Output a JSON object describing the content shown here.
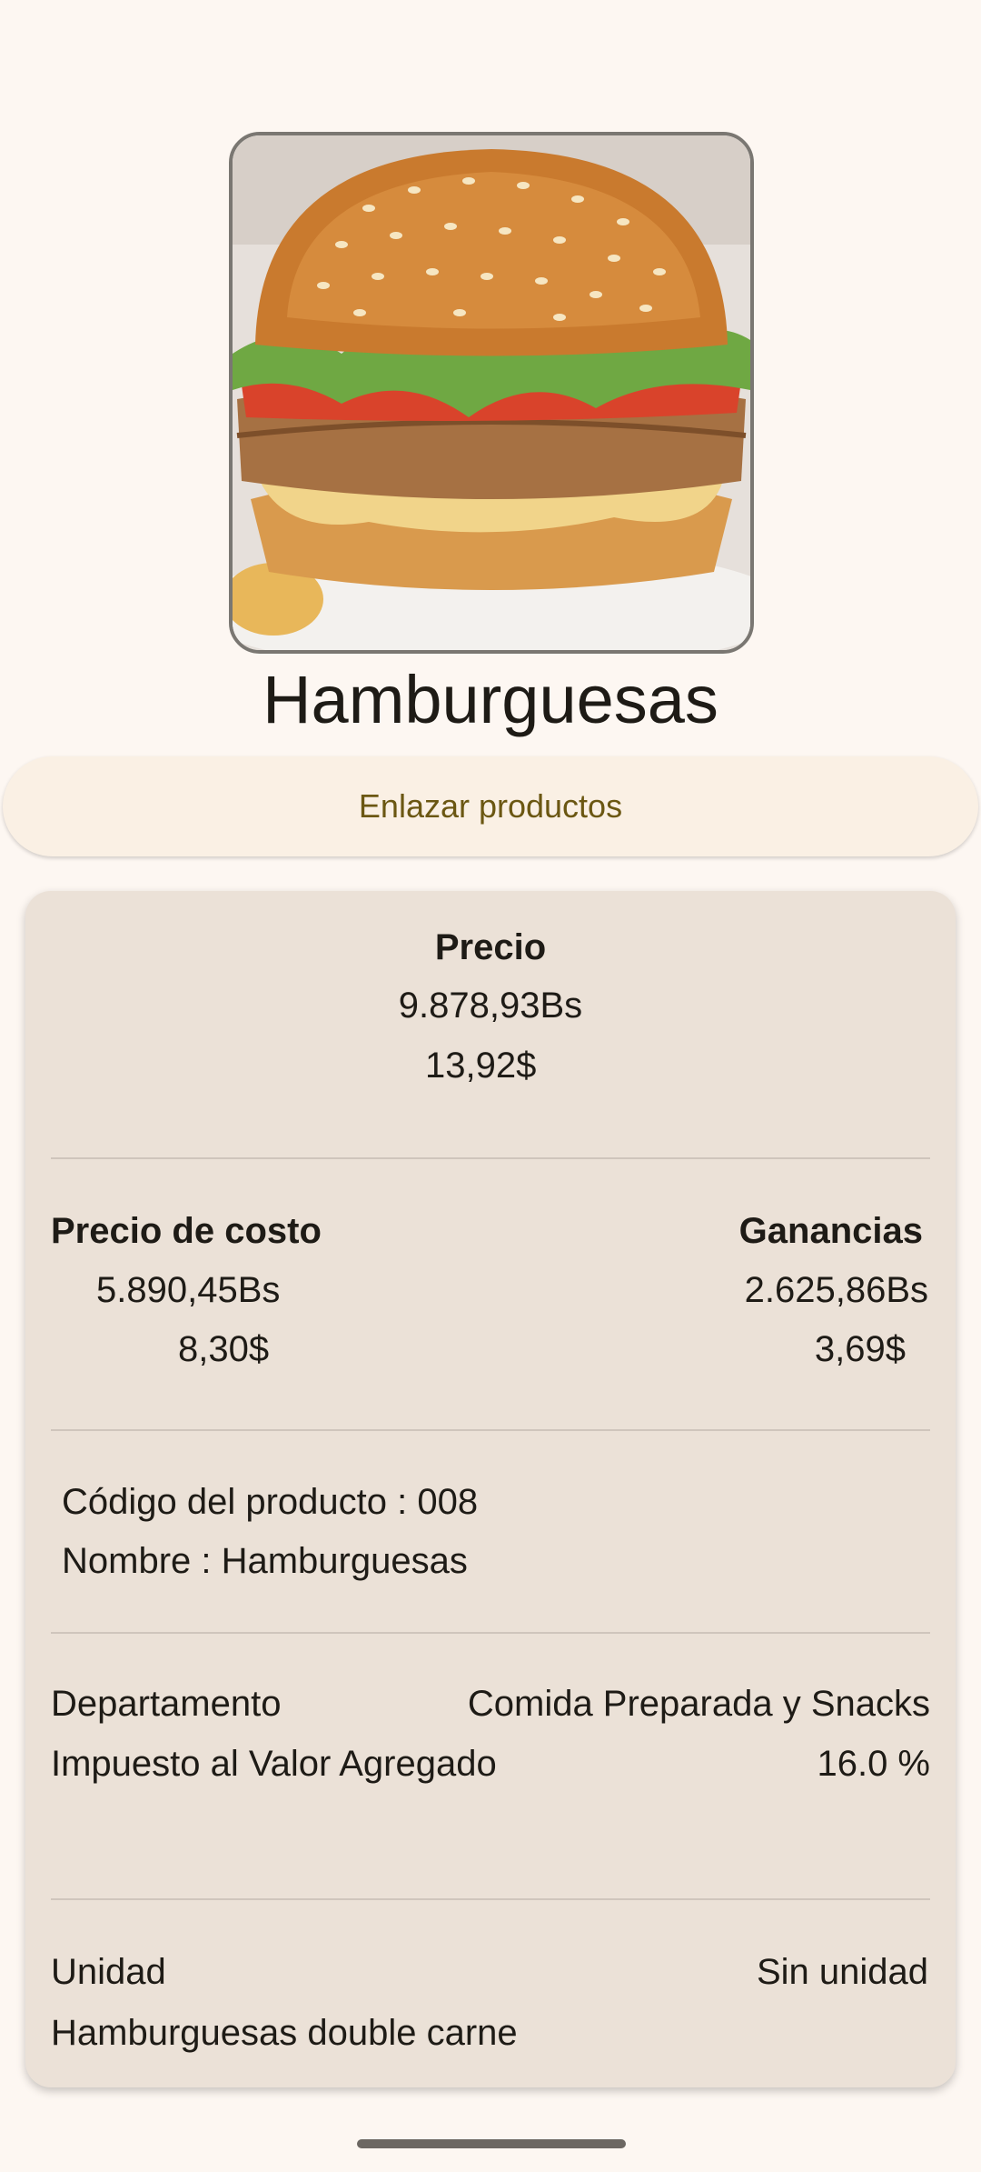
{
  "product": {
    "title": "Hamburguesas",
    "image_alt": "hamburger-photo"
  },
  "link_button": {
    "label": "Enlazar productos"
  },
  "price": {
    "heading": "Precio",
    "bs": "9.878,93Bs",
    "usd": "13,92$"
  },
  "cost": {
    "heading": "Precio de costo",
    "bs": "5.890,45Bs",
    "usd": "8,30$"
  },
  "profit": {
    "heading": "Ganancias",
    "bs": "2.625,86Bs",
    "usd": "3,69$"
  },
  "details": {
    "code": "Código del producto : 008",
    "name": "Nombre : Hamburguesas"
  },
  "department": {
    "label": "Departamento",
    "value": "Comida Preparada y Snacks"
  },
  "tax": {
    "label": "Impuesto al Valor Agregado",
    "value": "16.0 %"
  },
  "unit": {
    "label": "Unidad",
    "value": "Sin unidad",
    "description": "Hamburguesas double carne"
  },
  "colors": {
    "background": "#fdf7f2",
    "card": "#ebe1d7",
    "button_text": "#6b5712"
  }
}
